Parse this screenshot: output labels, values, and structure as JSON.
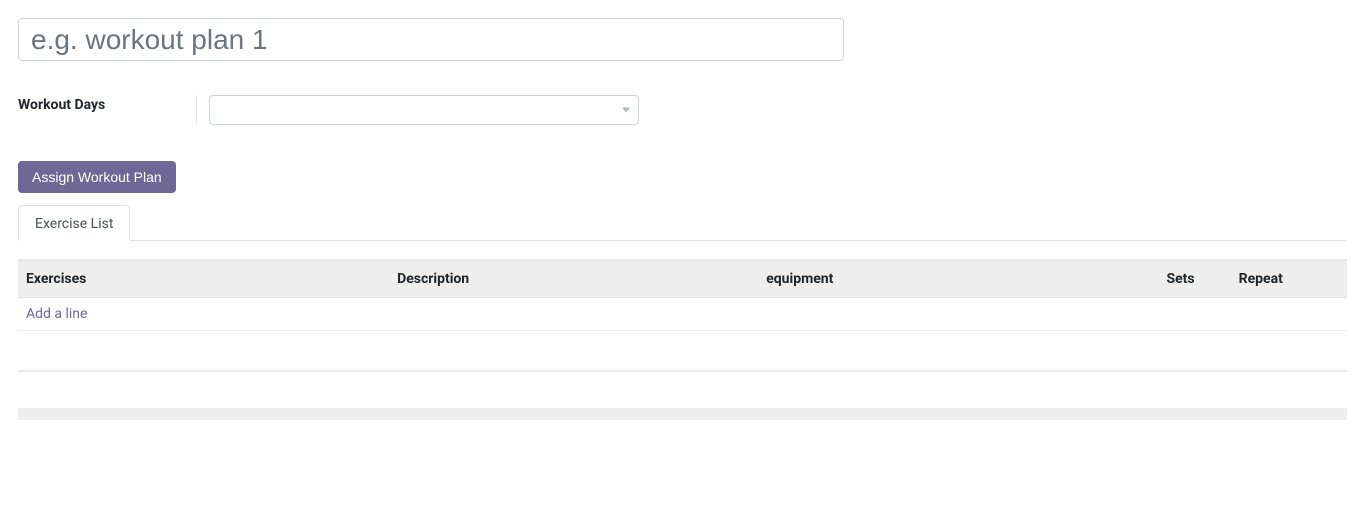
{
  "title": {
    "value": "",
    "placeholder": "e.g. workout plan 1"
  },
  "fields": {
    "workout_days_label": "Workout Days",
    "workout_days_value": ""
  },
  "buttons": {
    "assign_workout_plan": "Assign Workout Plan"
  },
  "tabs": [
    {
      "id": "exercise_list",
      "label": "Exercise List",
      "active": true
    }
  ],
  "table": {
    "columns": {
      "exercises": "Exercises",
      "description": "Description",
      "equipment": "equipment",
      "sets": "Sets",
      "repeat": "Repeat"
    },
    "rows": [],
    "add_line_label": "Add a line"
  }
}
